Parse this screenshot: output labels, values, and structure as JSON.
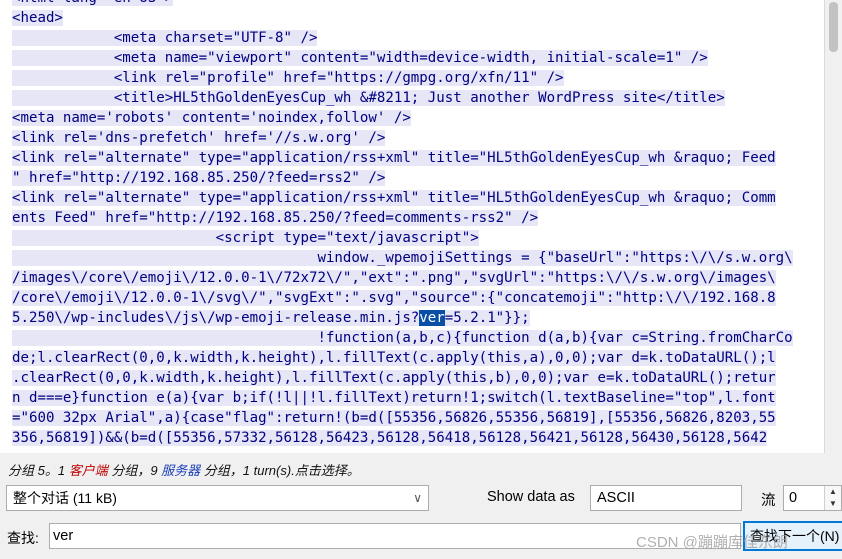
{
  "stream": {
    "lines": [
      "<html lang=\"en-US\">",
      "<head>",
      "            <meta charset=\"UTF-8\" />",
      "            <meta name=\"viewport\" content=\"width=device-width, initial-scale=1\" />",
      "            <link rel=\"profile\" href=\"https://gmpg.org/xfn/11\" />",
      "            <title>HL5thGoldenEyesCup_wh &#8211; Just another WordPress site</title>",
      "<meta name='robots' content='noindex,follow' />",
      "<link rel='dns-prefetch' href='//s.w.org' />",
      "<link rel=\"alternate\" type=\"application/rss+xml\" title=\"HL5thGoldenEyesCup_wh &raquo; Feed",
      "\" href=\"http://192.168.85.250/?feed=rss2\" />",
      "<link rel=\"alternate\" type=\"application/rss+xml\" title=\"HL5thGoldenEyesCup_wh &raquo; Comm",
      "ents Feed\" href=\"http://192.168.85.250/?feed=comments-rss2\" />",
      "                        <script type=\"text/javascript\">",
      "                                    window._wpemojiSettings = {\"baseUrl\":\"https:\\/\\/s.w.org\\",
      "/images\\/core\\/emoji\\/12.0.0-1\\/72x72\\/\",\"ext\":\".png\",\"svgUrl\":\"https:\\/\\/s.w.org\\/images\\",
      "/core\\/emoji\\/12.0.0-1\\/svg\\/\",\"svgExt\":\".svg\",\"source\":{\"concatemoji\":\"http:\\/\\/192.168.8",
      "5.250\\/wp-includes\\/js\\/wp-emoji-release.min.js?",
      "                                    !function(a,b,c){function d(a,b){var c=String.fromCharCo",
      "de;l.clearRect(0,0,k.width,k.height),l.fillText(c.apply(this,a),0,0);var d=k.toDataURL();l",
      ".clearRect(0,0,k.width,k.height),l.fillText(c.apply(this,b),0,0);var e=k.toDataURL();retur",
      "n d===e}function e(a){var b;if(!l||!l.fillText)return!1;switch(l.textBaseline=\"top\",l.font",
      "=\"600 32px Arial\",a){case\"flag\":return!(b=d([55356,56826,55356,56819],[55356,56826,8203,55",
      "356,56819])&&(b=d([55356,57332,56128,56423,56128,56418,56128,56421,56128,56430,56128,5642"
    ],
    "highlight_line": 16,
    "highlight_before": "5.250\\/wp-includes\\/js\\/wp-emoji-release.min.js?",
    "highlight_match": "ver",
    "highlight_after": "=5.2.1\"}};"
  },
  "status": {
    "prefix": "分组 5。1 ",
    "client": "客户端",
    "middle": " 分组，9 ",
    "server": "服务器",
    "suffix": " 分组，1 turn(s).点击选择。"
  },
  "controls": {
    "conversation_value": "整个对话 (11 kB)",
    "show_data_label": "Show data as",
    "format_value": "ASCII",
    "stream_label": "流",
    "stream_value": "0"
  },
  "find": {
    "label": "查找:",
    "value": "ver",
    "next_button": "查找下一个(N)"
  },
  "watermark": "CSDN @蹦蹦库佳东朗"
}
